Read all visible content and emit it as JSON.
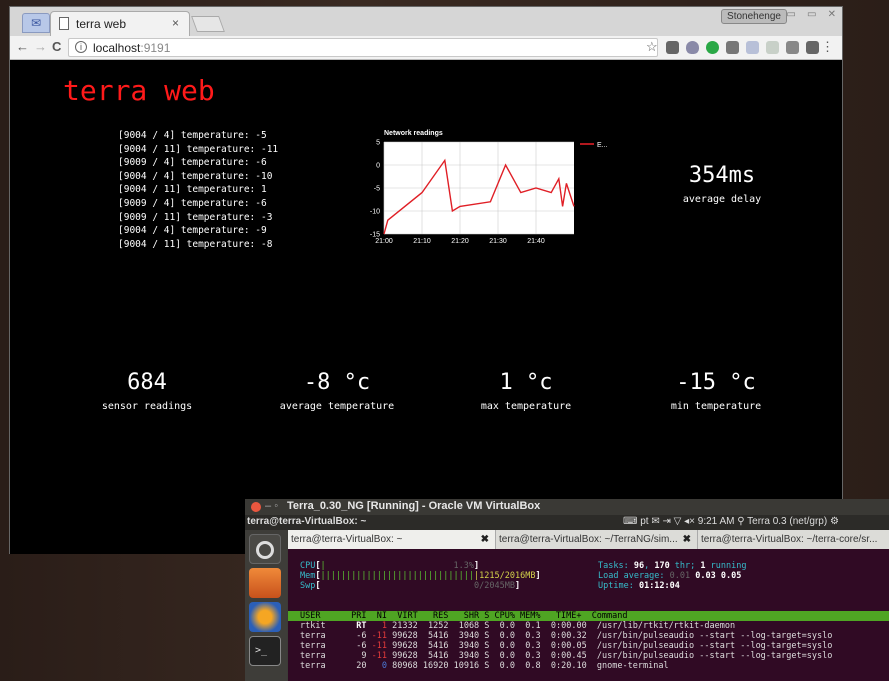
{
  "browser": {
    "tab_title": "terra web",
    "tab_close": "×",
    "profile_name": "Stonehenge",
    "url_host": "localhost",
    "url_port": ":9191",
    "info_glyph": "i",
    "back_glyph": "←",
    "forward_glyph": "→",
    "reload_glyph": "C",
    "star_glyph": "☆",
    "menu_glyph": "⋮",
    "window_buttons": "▭ ▭ ✕"
  },
  "page": {
    "title": "terra web",
    "readings": [
      "[9004 / 4] temperature: -5",
      "[9004 / 11] temperature: -11",
      "[9009 / 4] temperature: -6",
      "[9004 / 4] temperature: -10",
      "[9004 / 11] temperature: 1",
      "[9009 / 4] temperature: -6",
      "[9009 / 11] temperature: -3",
      "[9004 / 4] temperature: -9",
      "[9004 / 11] temperature: -8"
    ],
    "stats": {
      "delay_value": "354ms",
      "delay_label": "average delay",
      "readings_value": "684",
      "readings_label": "sensor readings",
      "avg_value": "-8 °c",
      "avg_label": "average temperature",
      "max_value": "1 °c",
      "max_label": "max temperature",
      "min_value": "-15 °c",
      "min_label": "min temperature"
    }
  },
  "chart_data": {
    "type": "line",
    "title": "Network readings",
    "xlabel": "",
    "ylabel": "",
    "x_ticks": [
      "21:00",
      "21:10",
      "21:20",
      "21:30",
      "21:40"
    ],
    "y_ticks": [
      5,
      0,
      -5,
      -10,
      -15
    ],
    "ylim": [
      -15,
      5
    ],
    "xlim": [
      0,
      50
    ],
    "grid": true,
    "legend": "top-right",
    "series": [
      {
        "name": "E...",
        "color": "#e01f26",
        "points": [
          [
            0,
            -15
          ],
          [
            1,
            -12
          ],
          [
            10,
            -6
          ],
          [
            16,
            1
          ],
          [
            18,
            -10
          ],
          [
            20,
            -9
          ],
          [
            28,
            -8
          ],
          [
            32,
            0
          ],
          [
            36,
            -6
          ],
          [
            40,
            -5
          ],
          [
            44,
            -6
          ],
          [
            46,
            -3
          ],
          [
            47,
            -9
          ],
          [
            48,
            -4
          ],
          [
            50,
            -9
          ]
        ]
      }
    ]
  },
  "vbox": {
    "title": "Terra_0.30_NG [Running] - Oracle VM VirtualBox",
    "title_dash": "–",
    "title_dot": "◦",
    "guest_host": "terra@terra-VirtualBox: ~",
    "tray": "⌨ pt  ✉  ⇥  ▽  ◂×   9:21 AM   ⚲ Terra 0.3 (net/grp)  ⚙",
    "tabs": [
      "terra@terra-VirtualBox: ~",
      "terra@terra-VirtualBox: ~/TerraNG/sim...",
      "terra@terra-VirtualBox: ~/terra-core/sr..."
    ],
    "tab_close": "✖"
  },
  "htop": {
    "cpu_label": "CPU",
    "cpu_bar": "|",
    "cpu_value": "1.3%",
    "mem_label": "Mem",
    "mem_bar": "||||||||||||||||||||||||||||||",
    "mem_value": "1215/2016MB",
    "swp_label": "Swp",
    "swp_value": "0/2045MB",
    "tasks_label": "Tasks: ",
    "tasks_count": "96",
    "tasks_sep": ", ",
    "tasks_thr": "170",
    "tasks_thr_label": " thr; ",
    "tasks_running": "1",
    "tasks_running_label": " running",
    "load_label": "Load average: ",
    "load1": "0.01",
    "load5": "0.03",
    "load15": "0.05",
    "uptime_label": "Uptime: ",
    "uptime": "01:12:04",
    "header": "USER      PRI  NI  VIRT   RES   SHR S CPU% MEM%   TIME+  Command",
    "rows": [
      {
        "user": "rtkit",
        "pri": "RT",
        "ni": "1",
        "virt": "21332",
        "res": "1252",
        "shr": "1068",
        "s": "S",
        "cpu": "0.0",
        "mem": "0.1",
        "time": "0:00.00",
        "cmd": "/usr/lib/rtkit/rtkit-daemon"
      },
      {
        "user": "terra",
        "pri": "-6",
        "ni": "-11",
        "virt": "99628",
        "res": "5416",
        "shr": "3940",
        "s": "S",
        "cpu": "0.0",
        "mem": "0.3",
        "time": "0:00.32",
        "cmd": "/usr/bin/pulseaudio --start --log-target=syslo"
      },
      {
        "user": "terra",
        "pri": "-6",
        "ni": "-11",
        "virt": "99628",
        "res": "5416",
        "shr": "3940",
        "s": "S",
        "cpu": "0.0",
        "mem": "0.3",
        "time": "0:00.05",
        "cmd": "/usr/bin/pulseaudio --start --log-target=syslo"
      },
      {
        "user": "terra",
        "pri": "9",
        "ni": "-11",
        "virt": "99628",
        "res": "5416",
        "shr": "3940",
        "s": "S",
        "cpu": "0.0",
        "mem": "0.3",
        "time": "0:00.45",
        "cmd": "/usr/bin/pulseaudio --start --log-target=syslo"
      },
      {
        "user": "terra",
        "pri": "20",
        "ni": "0",
        "virt": "80968",
        "res": "16920",
        "shr": "10916",
        "s": "S",
        "cpu": "0.0",
        "mem": "0.8",
        "time": "0:20.10",
        "cmd": "gnome-terminal"
      }
    ]
  }
}
